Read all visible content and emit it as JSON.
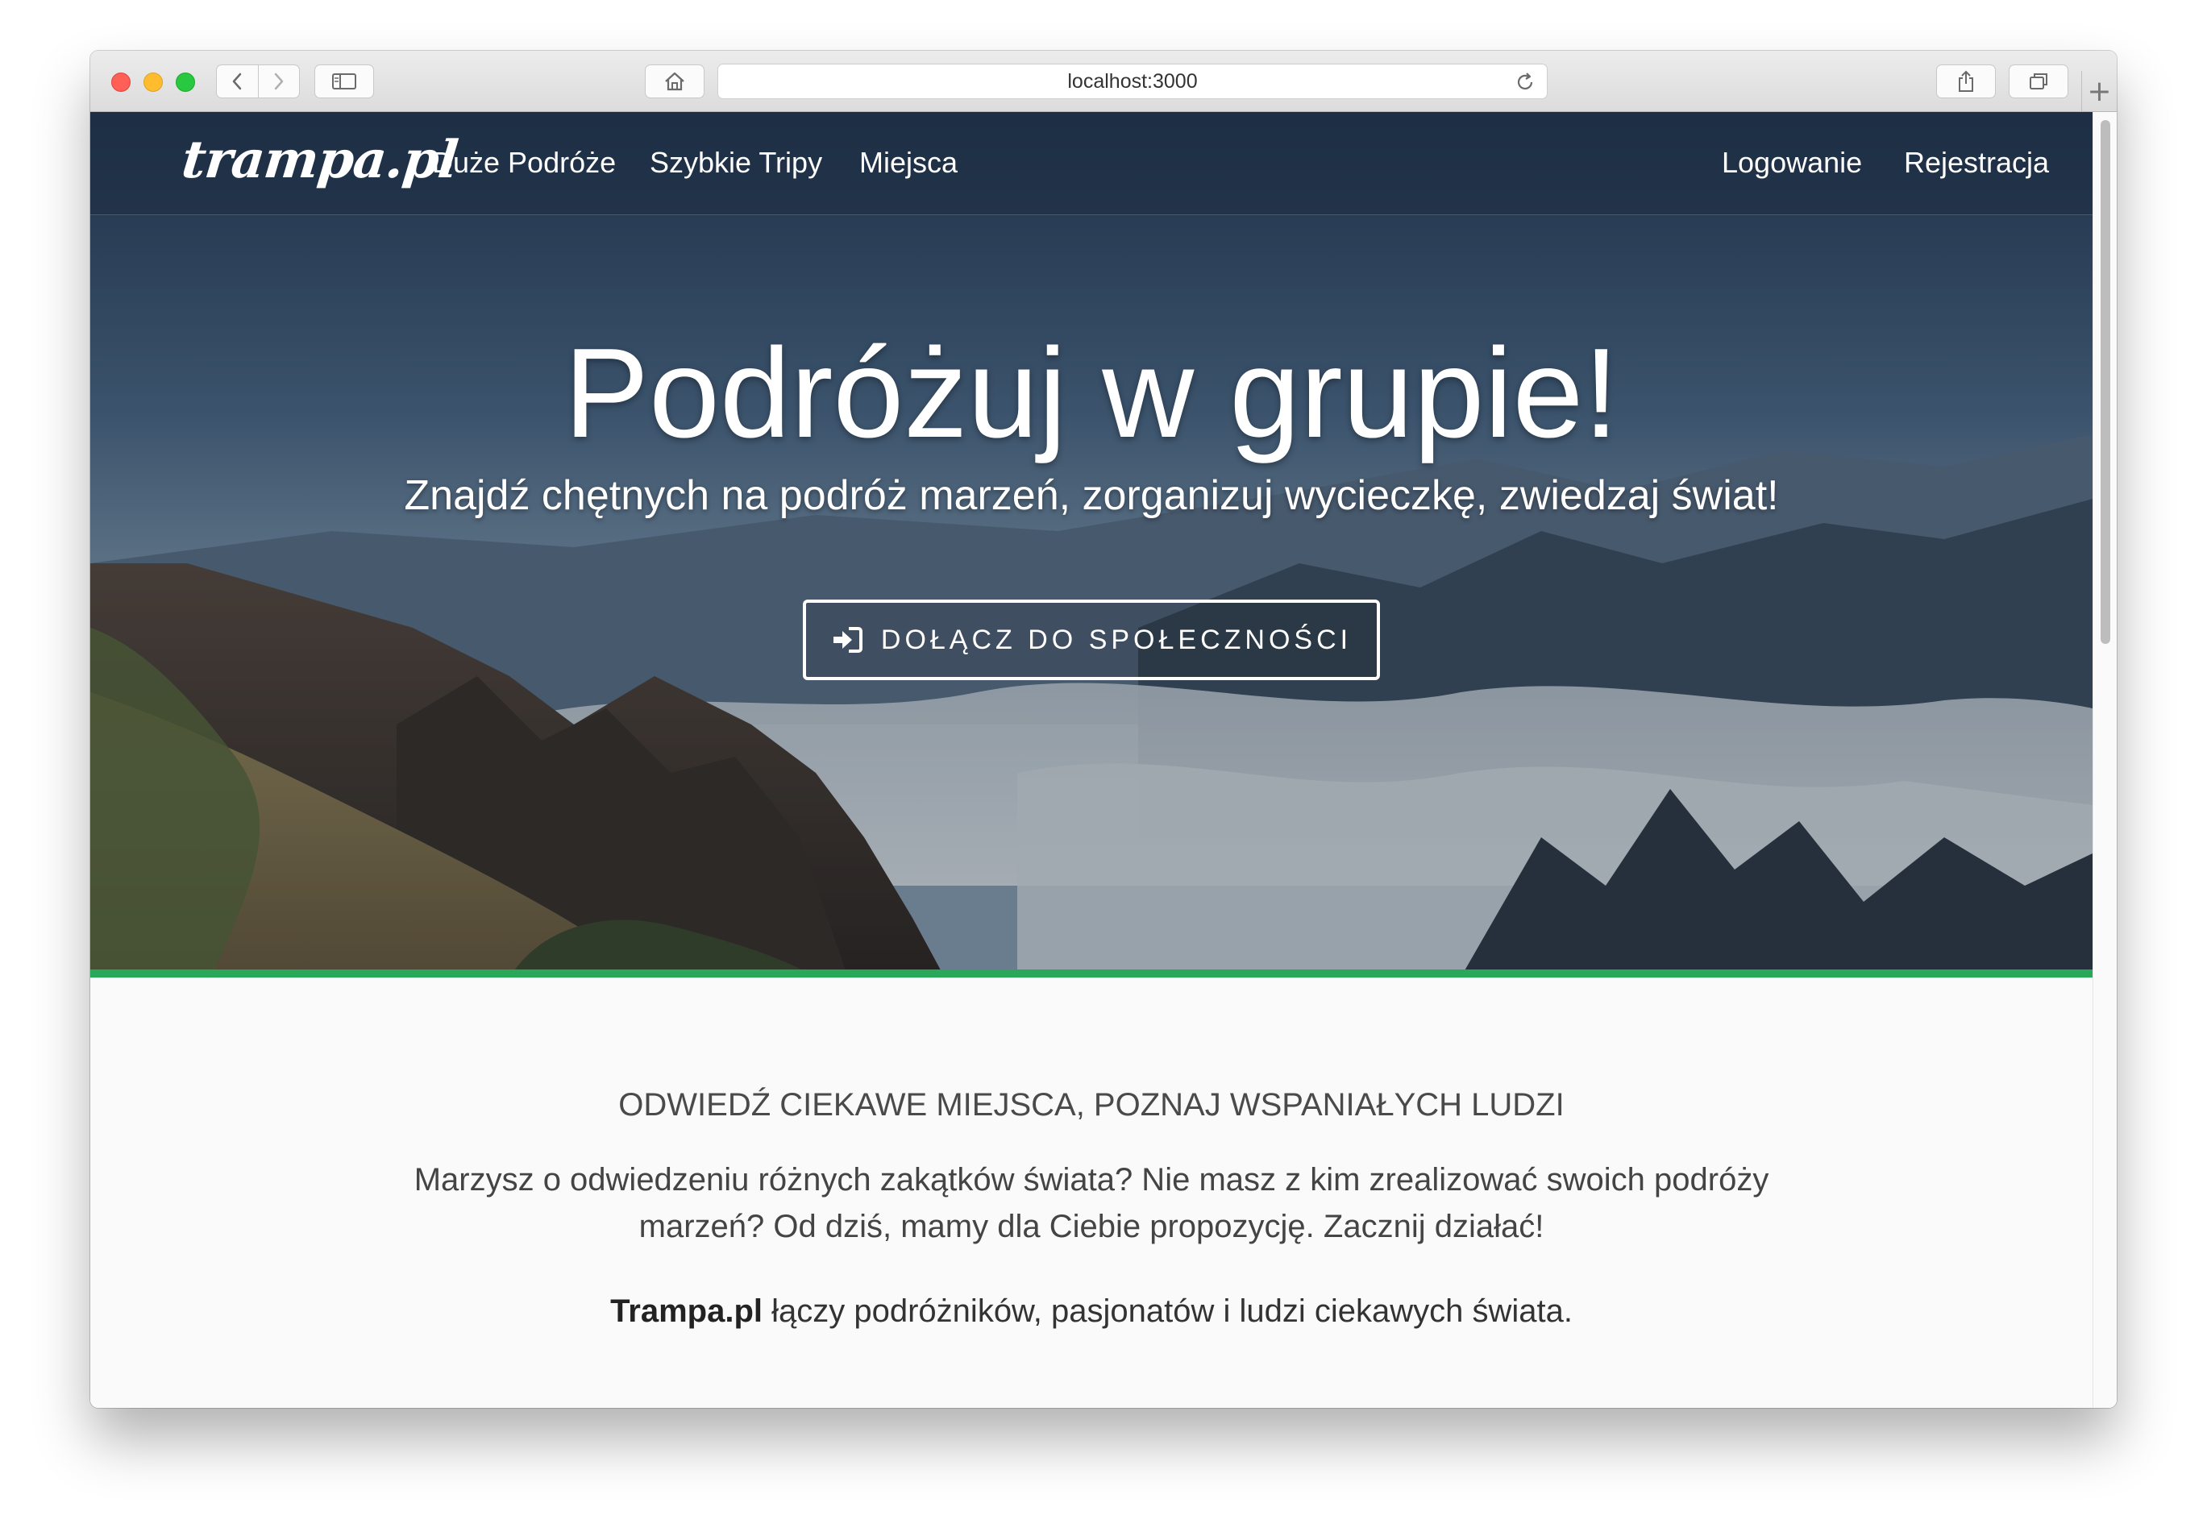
{
  "browser": {
    "url": "localhost:3000",
    "icons": {
      "back": "chevron-left-icon",
      "forward": "chevron-right-icon",
      "sidebar": "sidebar-icon",
      "home": "home-icon",
      "reload": "reload-icon",
      "share": "share-icon",
      "tabs": "tabs-overview-icon",
      "new_tab": "plus-icon"
    },
    "new_tab_glyph": "+"
  },
  "navbar": {
    "brand": "trampa.pl",
    "links": [
      "Duże Podróże",
      "Szybkie Tripy",
      "Miejsca"
    ],
    "login": "Logowanie",
    "register": "Rejestracja"
  },
  "hero": {
    "title": "Podróżuj w grupie!",
    "subtitle": "Znajdź chętnych na podróż marzeń, zorganizuj wycieczkę, zwiedzaj świat!",
    "cta_label": "DOŁĄCZ DO SPOŁECZNOŚCI",
    "cta_icon": "sign-in-icon",
    "accent_color": "#2aa85a"
  },
  "content": {
    "heading": "ODWIEDŹ CIEKAWE MIEJSCA, POZNAJ WSPANIAŁYCH LUDZI",
    "paragraph": "Marzysz o odwiedzeniu różnych zakątków świata? Nie masz z kim zrealizować swoich podróży marzeń? Od dziś, mamy dla Ciebie propozycję. Zacznij działać!",
    "tagline_bold": "Trampa.pl",
    "tagline_rest": " łączy podróżników, pasjonatów i ludzi ciekawych świata."
  }
}
